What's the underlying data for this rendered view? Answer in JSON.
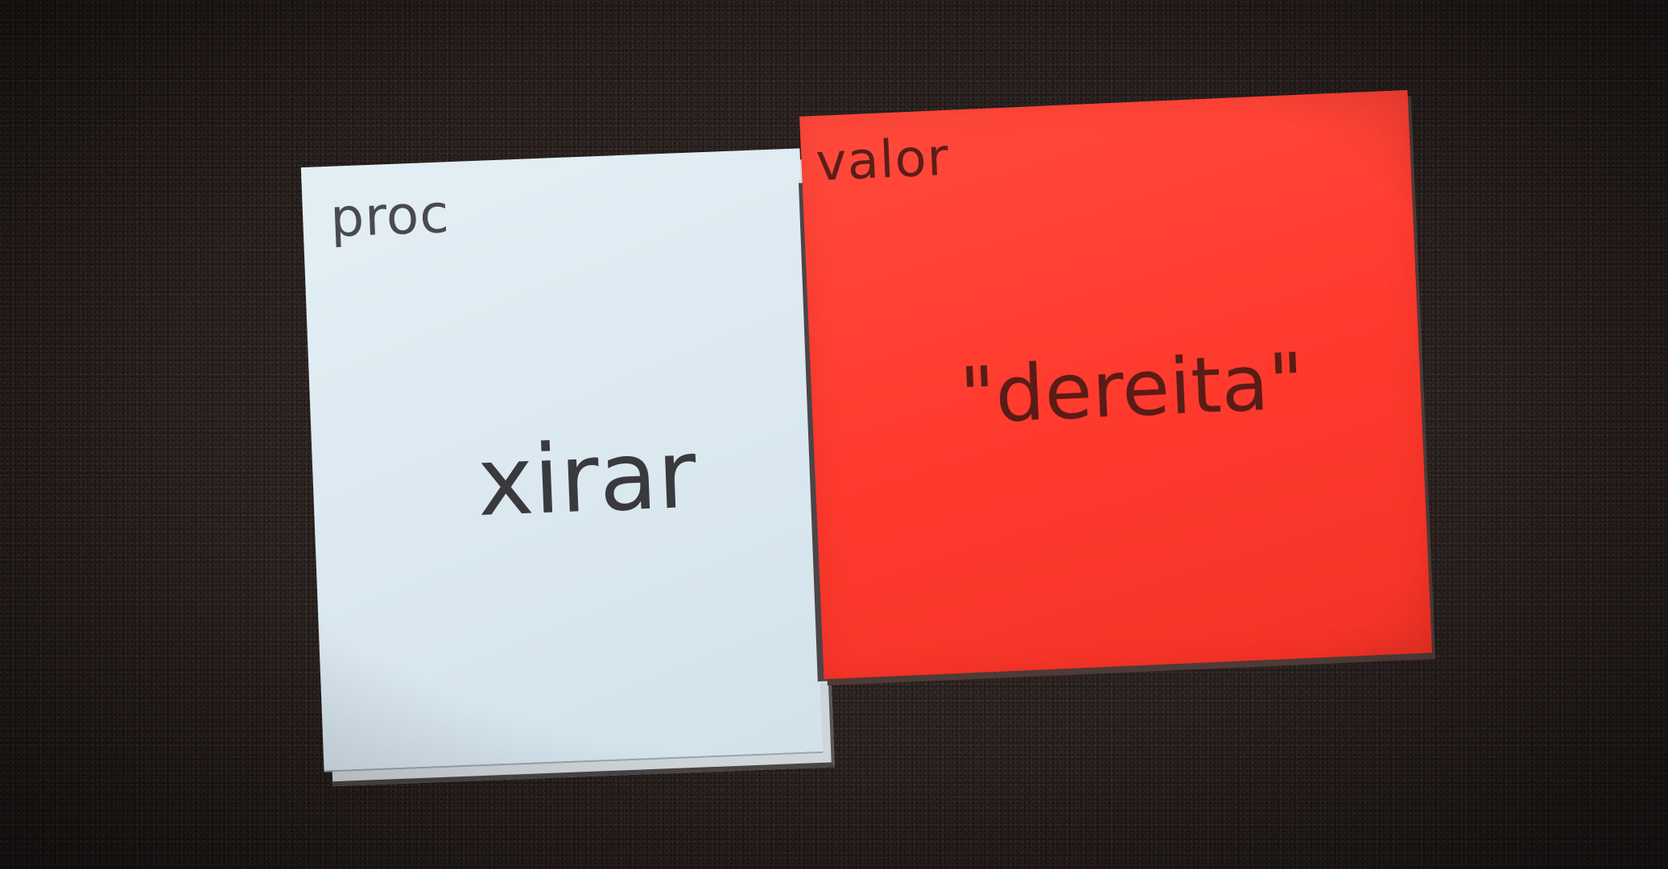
{
  "scene": {
    "description_colors": {
      "table_surface": "#2a2220",
      "proc_card": "#dde9f0",
      "value_card": "#ff3d30"
    }
  },
  "cards": {
    "proc": {
      "type_label": "proc",
      "content": "xirar"
    },
    "value": {
      "type_label": "valor",
      "content": "\"dereita\""
    }
  }
}
